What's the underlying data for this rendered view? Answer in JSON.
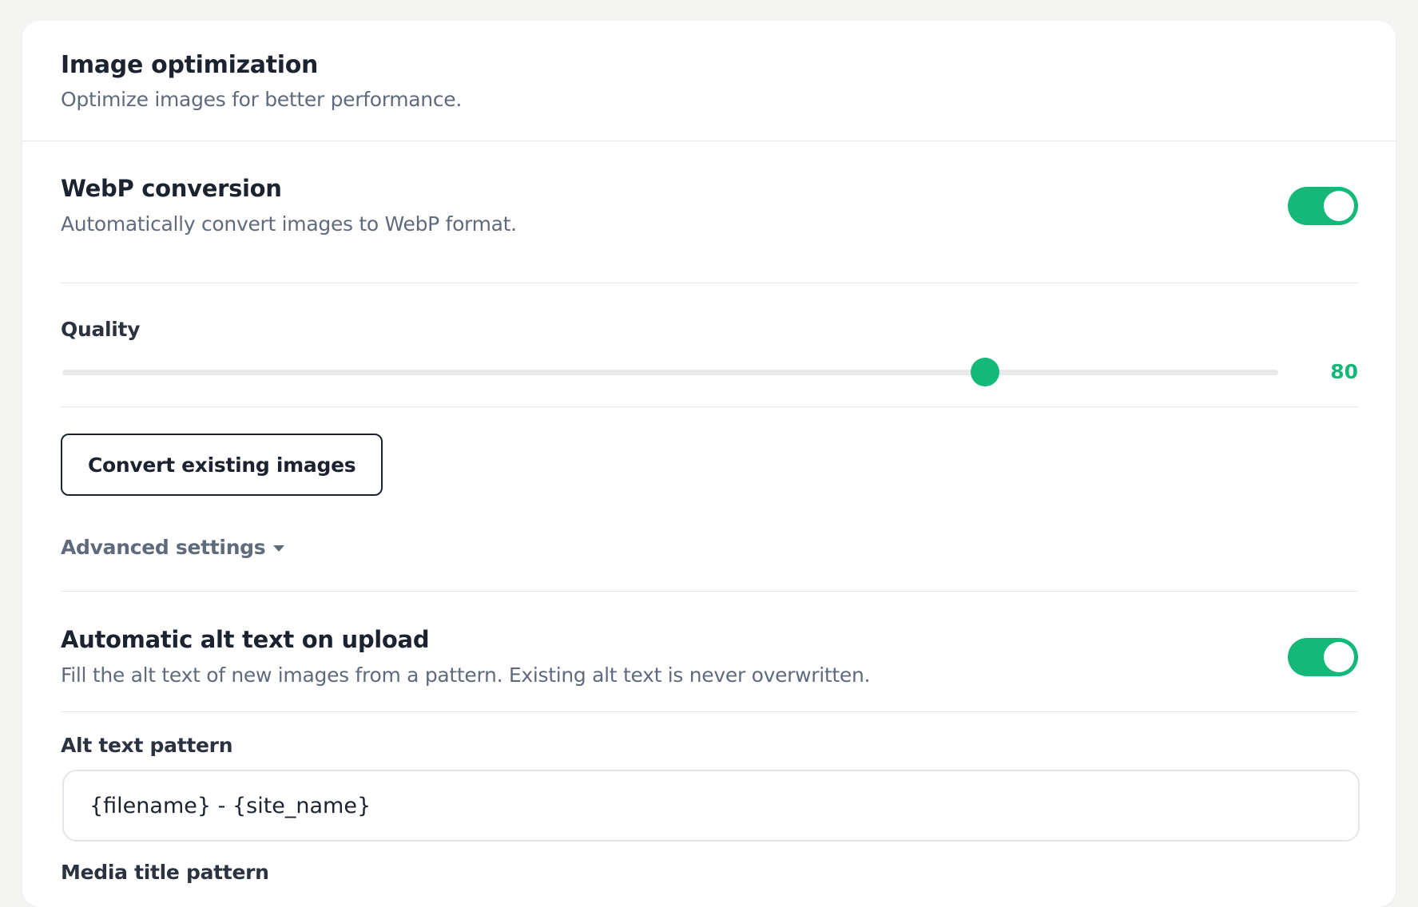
{
  "card": {
    "title": "Image optimization",
    "subtitle": "Optimize images for better performance."
  },
  "webp": {
    "title": "WebP conversion",
    "description": "Automatically convert images to WebP format.",
    "enabled": true
  },
  "quality": {
    "label": "Quality",
    "value": "80",
    "min": 0,
    "max": 100
  },
  "convert_button": {
    "label": "Convert existing images"
  },
  "advanced": {
    "label": "Advanced settings"
  },
  "alt_text": {
    "title": "Automatic alt text on upload",
    "description": "Fill the alt text of new images from a pattern. Existing alt text is never overwritten.",
    "enabled": true
  },
  "alt_pattern": {
    "label": "Alt text pattern",
    "value": "{filename} - {site_name}"
  },
  "media_title_pattern": {
    "label": "Media title pattern"
  },
  "colors": {
    "accent": "#14b878",
    "text_primary": "#1c2330",
    "text_muted": "#5f6b7c",
    "divider": "#e4e6ea",
    "page_bg": "#f4f4f2"
  }
}
